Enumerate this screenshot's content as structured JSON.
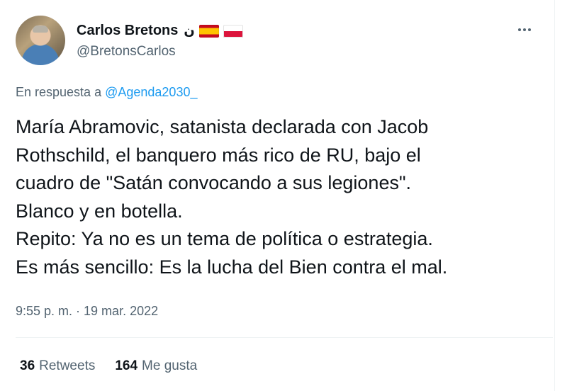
{
  "author": {
    "display_name": "Carlos Bretons",
    "extra_glyph": "ن",
    "handle": "@BretonsCarlos",
    "flags": [
      "spain-flag",
      "poland-flag"
    ]
  },
  "reply": {
    "prefix": "En respuesta a",
    "mention": "@Agenda2030_"
  },
  "tweet": {
    "text": "María Abramovic, satanista declarada con Jacob\nRothschild, el banquero más rico de RU, bajo el\ncuadro de \"Satán convocando a sus legiones\".\nBlanco y en botella.\nRepito: Ya no es un tema de política o estrategia.\nEs más sencillo: Es la lucha del Bien contra el mal.",
    "timestamp": "9:55 p. m. · 19 mar. 2022"
  },
  "stats": {
    "retweets_count": "36",
    "retweets_label": "Retweets",
    "likes_count": "164",
    "likes_label": "Me gusta"
  },
  "colors": {
    "link": "#1d9bf0",
    "secondary_text": "#536471",
    "primary_text": "#0f1419"
  }
}
